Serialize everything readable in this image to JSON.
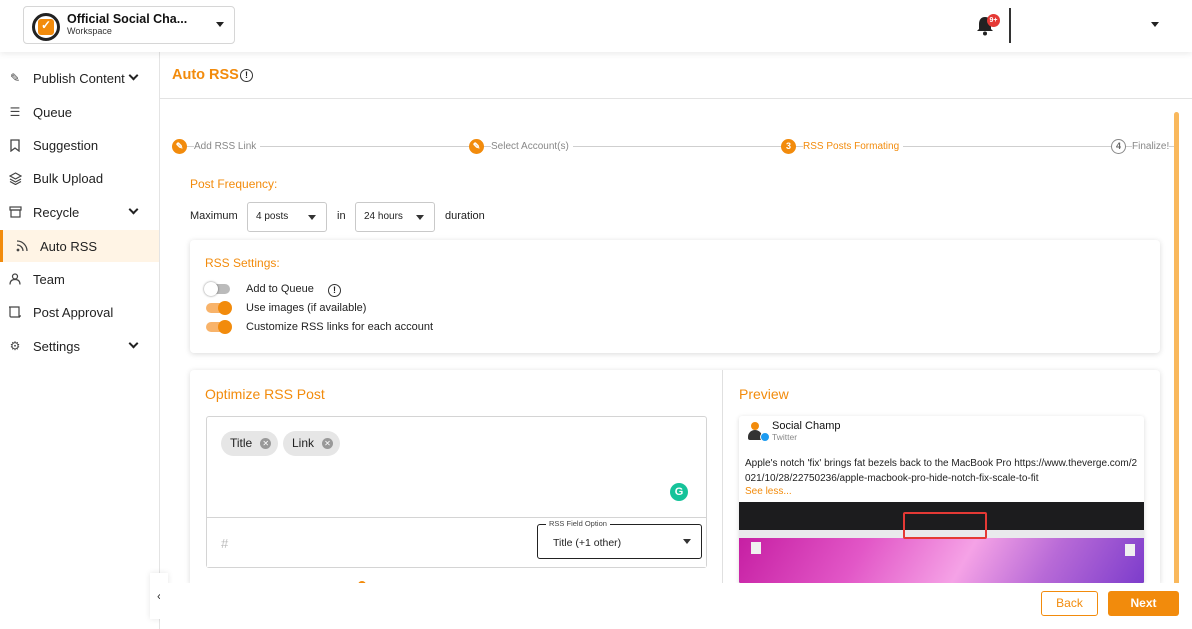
{
  "workspace": {
    "name": "Official Social Cha...",
    "subtitle": "Workspace"
  },
  "notifications": {
    "badge": "9+"
  },
  "sidebar": {
    "items": [
      {
        "label": "Publish Content",
        "icon": "pen-icon"
      },
      {
        "label": "Queue",
        "icon": "list-icon"
      },
      {
        "label": "Suggestion",
        "icon": "bookmark-icon"
      },
      {
        "label": "Bulk Upload",
        "icon": "layers-icon"
      },
      {
        "label": "Recycle",
        "icon": "archive-icon"
      },
      {
        "label": "Auto RSS",
        "icon": "rss-icon"
      },
      {
        "label": "Team",
        "icon": "user-icon"
      },
      {
        "label": "Post Approval",
        "icon": "scroll-icon"
      },
      {
        "label": "Settings",
        "icon": "gear-icon"
      }
    ]
  },
  "page": {
    "title": "Auto RSS"
  },
  "steps": [
    {
      "label": "Add RSS Link",
      "marker": "✎",
      "state": "done"
    },
    {
      "label": "Select Account(s)",
      "marker": "✎",
      "state": "done"
    },
    {
      "label": "RSS Posts Formating",
      "marker": "3",
      "state": "current"
    },
    {
      "label": "Finalize!",
      "marker": "4",
      "state": "pending"
    }
  ],
  "post_frequency": {
    "label": "Post Frequency:",
    "prefix": "Maximum",
    "posts_value": "4 posts",
    "in_label": "in",
    "hours_value": "24 hours",
    "suffix": "duration"
  },
  "rss_settings": {
    "title": "RSS Settings:",
    "toggles": [
      {
        "label": "Add to Queue",
        "on": false
      },
      {
        "label": "Use images (if available)",
        "on": true
      },
      {
        "label": "Customize RSS links for each account",
        "on": true
      }
    ]
  },
  "optimize": {
    "title": "Optimize RSS Post",
    "chips": [
      "Title",
      "Link"
    ],
    "hash_placeholder": "#",
    "field_option_label": "RSS Field Option",
    "field_option_value": "Title (+1 other)"
  },
  "preview": {
    "title": "Preview",
    "account_name": "Social Champ",
    "network": "Twitter",
    "text": "Apple's notch 'fix' brings fat bezels back to the MacBook Pro  https://www.theverge.com/2021/10/28/22750236/apple-macbook-pro-hide-notch-fix-scale-to-fit",
    "see_less": "See less..."
  },
  "footer": {
    "back": "Back",
    "next": "Next"
  },
  "colors": {
    "accent": "#f28b0c",
    "badge": "#e53935",
    "twitter": "#1d9bf0",
    "grammarly": "#15c39a"
  }
}
